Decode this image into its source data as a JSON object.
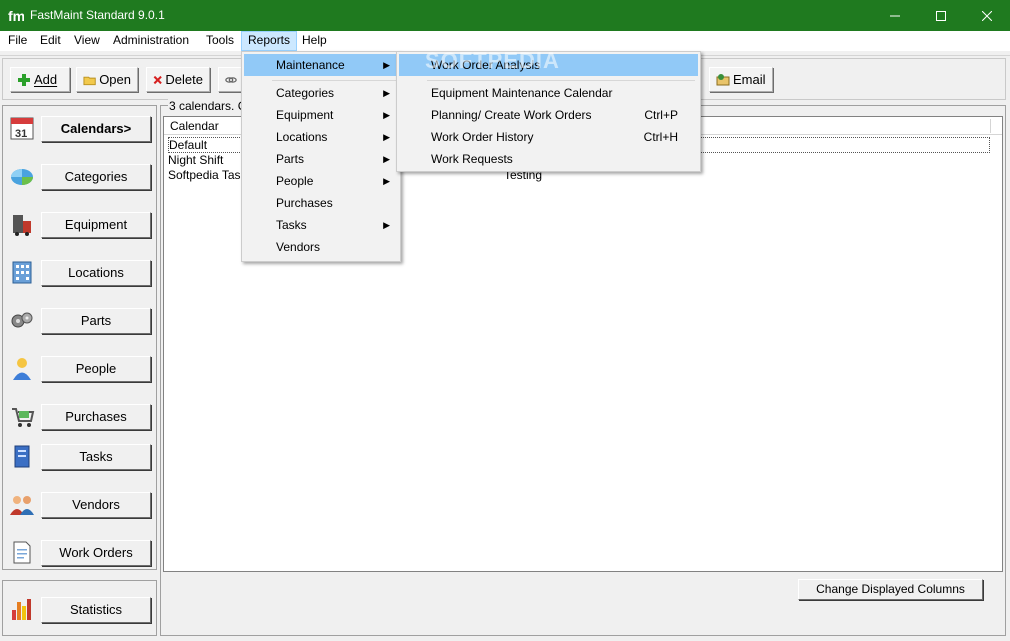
{
  "window": {
    "title": "FastMaint Standard 9.0.1"
  },
  "menubar": [
    "File",
    "Edit",
    "View",
    "Administration",
    "Tools",
    "Reports",
    "Help"
  ],
  "toolbar": {
    "add": "Add",
    "open": "Open",
    "delete": "Delete",
    "email": "Email"
  },
  "nav": [
    {
      "label": "Calendars>",
      "icon": "calendar-icon"
    },
    {
      "label": "Categories",
      "icon": "categories-icon"
    },
    {
      "label": "Equipment",
      "icon": "equipment-icon"
    },
    {
      "label": "Locations",
      "icon": "locations-icon"
    },
    {
      "label": "Parts",
      "icon": "parts-icon"
    },
    {
      "label": "People",
      "icon": "people-icon"
    },
    {
      "label": "Purchases",
      "icon": "purchases-icon"
    },
    {
      "label": "Tasks",
      "icon": "tasks-icon"
    },
    {
      "label": "Vendors",
      "icon": "vendors-icon"
    },
    {
      "label": "Work Orders",
      "icon": "work-orders-icon"
    }
  ],
  "statistics_label": "Statistics",
  "main": {
    "info_text": "3 calendars. C",
    "column_header": "Calendar",
    "rows": [
      {
        "name": "Default",
        "desc": ""
      },
      {
        "name": "Night Shift",
        "desc": ""
      },
      {
        "name": "Softpedia Tas",
        "desc": "Testing"
      }
    ],
    "change_columns_label": "Change Displayed Columns"
  },
  "reports_menu": {
    "items": [
      "Maintenance",
      "Categories",
      "Equipment",
      "Locations",
      "Parts",
      "People",
      "Purchases",
      "Tasks",
      "Vendors"
    ]
  },
  "maintenance_submenu": {
    "items": [
      {
        "label": "Work Order Analysis",
        "shortcut": ""
      },
      {
        "label": "Equipment Maintenance Calendar",
        "shortcut": ""
      },
      {
        "label": "Planning/ Create Work Orders",
        "shortcut": "Ctrl+P"
      },
      {
        "label": "Work Order History",
        "shortcut": "Ctrl+H"
      },
      {
        "label": "Work Requests",
        "shortcut": ""
      }
    ]
  },
  "watermark": "SOFTPEDIA",
  "colors": {
    "titlebar": "#1f7a1f",
    "menu_highlight": "#91c9f7",
    "menubar_active": "#cce8ff"
  }
}
